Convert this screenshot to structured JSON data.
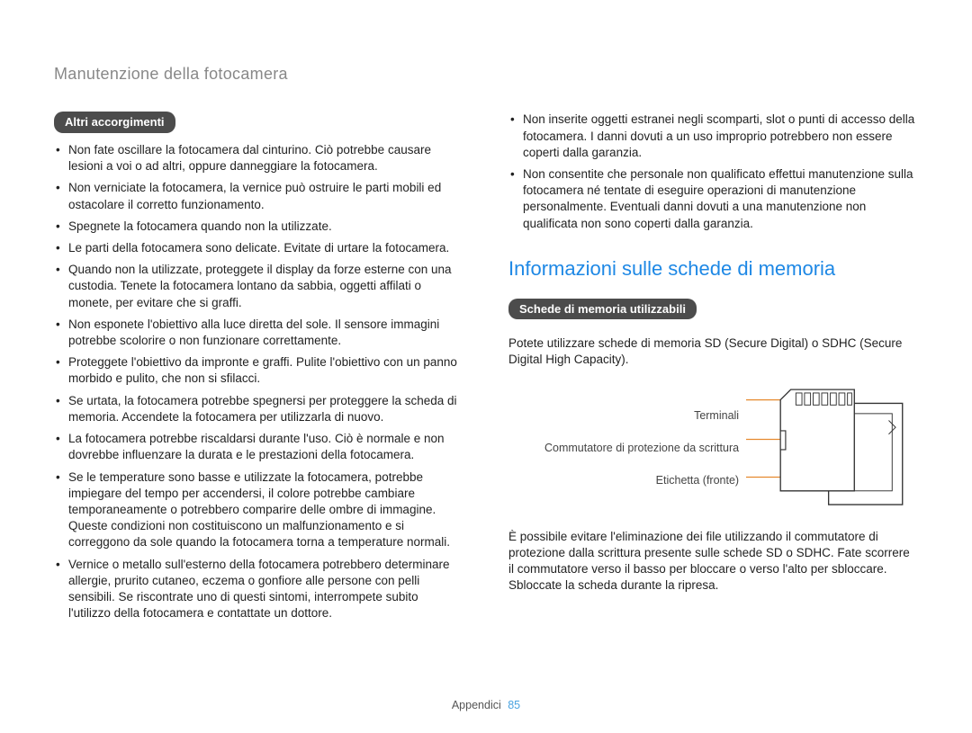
{
  "header": "Manutenzione della fotocamera",
  "left": {
    "pill": "Altri accorgimenti",
    "items": [
      "Non fate oscillare la fotocamera dal cinturino. Ciò potrebbe causare lesioni a voi o ad altri, oppure danneggiare la fotocamera.",
      "Non verniciate la fotocamera, la vernice può ostruire le parti mobili ed ostacolare il corretto funzionamento.",
      "Spegnete la fotocamera quando non la utilizzate.",
      "Le parti della fotocamera sono delicate.  Evitate di urtare la fotocamera.",
      "Quando non la utilizzate, proteggete il display da forze esterne con una custodia. Tenete la fotocamera lontano da sabbia, oggetti affilati o monete, per evitare che si graffi.",
      "Non esponete l'obiettivo alla luce diretta del sole. Il sensore immagini potrebbe scolorire o non funzionare correttamente.",
      "Proteggete l'obiettivo da impronte e graffi. Pulite l'obiettivo con un panno morbido e pulito, che non si sfilacci.",
      "Se urtata, la fotocamera potrebbe spegnersi  per proteggere la scheda di memoria. Accendete la fotocamera per utilizzarla di nuovo.",
      "La fotocamera potrebbe riscaldarsi durante l'uso.  Ciò è normale e non dovrebbe influenzare la durata e le prestazioni della fotocamera.",
      "Se le temperature sono basse e utilizzate la fotocamera, potrebbe impiegare del tempo per accendersi, il colore potrebbe cambiare temporaneamente o potrebbero comparire delle ombre di immagine. Queste condizioni non costituiscono un malfunzionamento e si correggono da sole quando la fotocamera torna a temperature normali.",
      "Vernice o metallo sull'esterno della fotocamera potrebbero determinare allergie, prurito cutaneo, eczema o gonfiore alle persone con pelli sensibili. Se riscontrate uno di questi sintomi, interrompete subito l'utilizzo della fotocamera e contattate un dottore."
    ]
  },
  "right_top_items": [
    "Non inserite oggetti estranei negli scomparti, slot o punti di accesso della fotocamera. I danni dovuti a un uso improprio potrebbero non essere coperti dalla garanzia.",
    "Non consentite che personale non qualificato effettui manutenzione sulla fotocamera né tentate di eseguire operazioni di manutenzione personalmente. Eventuali danni dovuti a una manutenzione non qualificata non sono coperti dalla garanzia."
  ],
  "right_section": {
    "title": "Informazioni sulle schede di memoria",
    "pill": "Schede di memoria utilizzabili",
    "intro": "Potete utilizzare schede di memoria SD (Secure Digital) o SDHC (Secure Digital High Capacity).",
    "labels": {
      "terminals": "Terminali",
      "switch": "Commutatore di protezione da scrittura",
      "label": "Etichetta (fronte)"
    },
    "bottom": "È possibile evitare l'eliminazione dei file utilizzando il commutatore di protezione dalla scrittura presente sulle schede SD o SDHC. Fate scorrere il commutatore verso il basso per bloccare o verso l'alto per sbloccare. Sbloccate la scheda durante la ripresa."
  },
  "footer": {
    "section": "Appendici",
    "page": "85"
  }
}
